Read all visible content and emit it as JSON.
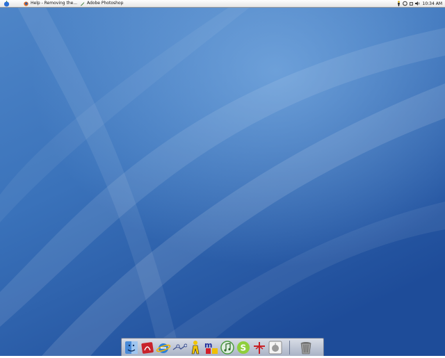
{
  "taskbar": {
    "apple_menu_icon": "apple-icon",
    "tasks": [
      {
        "label": "Help - Removing the...",
        "icon": "firefox-icon"
      },
      {
        "label": "Adobe Photoshop",
        "icon": "photoshop-feather-icon"
      }
    ],
    "tray_icons": [
      "aim-icon",
      "sync-icon",
      "wifi-icon",
      "volume-icon"
    ],
    "clock": "10:34 AM"
  },
  "dock": {
    "apps": [
      {
        "name": "Finder",
        "icon": "finder-icon"
      },
      {
        "name": "Acrobat",
        "icon": "acrobat-icon"
      },
      {
        "name": "Internet Explorer",
        "icon": "internet-explorer-icon"
      },
      {
        "name": "Network",
        "icon": "network-icon"
      },
      {
        "name": "AIM",
        "icon": "aim-running-man-icon"
      },
      {
        "name": "Messenger",
        "icon": "msn-messenger-icon"
      },
      {
        "name": "iTunes",
        "icon": "itunes-icon"
      },
      {
        "name": "Skype",
        "icon": "skype-icon"
      },
      {
        "name": "Antenna",
        "icon": "antenna-icon"
      },
      {
        "name": "Apple",
        "icon": "apple-logo-icon"
      }
    ],
    "trash": {
      "icon": "trash-icon"
    }
  },
  "colors": {
    "desktop_top": "#5b90cf",
    "desktop_bottom": "#1f4f9c",
    "taskbar_bg": "#eeeeee",
    "dock_bg": "#c4cbda"
  }
}
